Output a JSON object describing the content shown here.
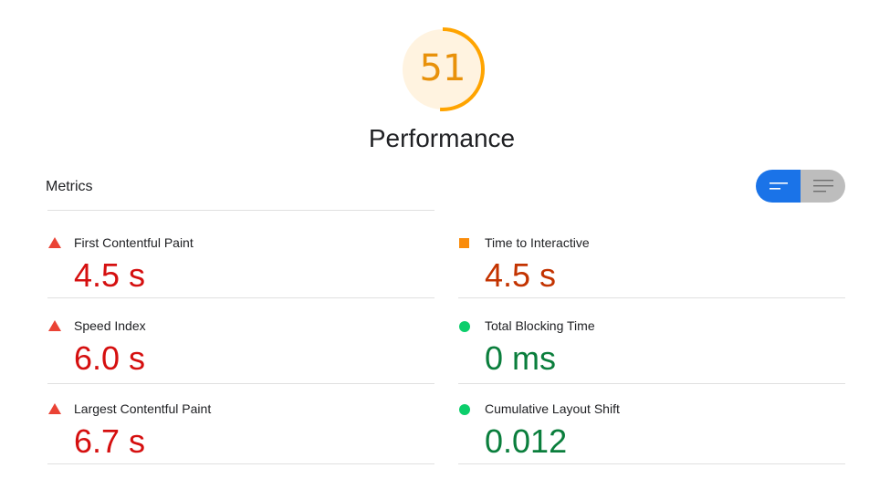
{
  "score": {
    "value": "51",
    "fraction": 0.51,
    "ring_color": "#ffa400",
    "fill_color": "#fff3e0",
    "text_color": "#e8910a"
  },
  "category_title": "Performance",
  "metrics_heading": "Metrics",
  "view_toggle": {
    "active": "compact-view",
    "items": [
      "compact-view-icon",
      "expanded-view-icon"
    ]
  },
  "metrics": [
    {
      "label": "First Contentful Paint",
      "value": "4.5 s",
      "status": "fail",
      "icon": "fail-triangle-icon",
      "color": "#d50f0f"
    },
    {
      "label": "Time to Interactive",
      "value": "4.5 s",
      "status": "average",
      "icon": "average-square-icon",
      "color": "#c33300"
    },
    {
      "label": "Speed Index",
      "value": "6.0 s",
      "status": "fail",
      "icon": "fail-triangle-icon",
      "color": "#d50f0f"
    },
    {
      "label": "Total Blocking Time",
      "value": "0 ms",
      "status": "pass",
      "icon": "pass-circle-icon",
      "color": "#0a7e3c"
    },
    {
      "label": "Largest Contentful Paint",
      "value": "6.7 s",
      "status": "fail",
      "icon": "fail-triangle-icon",
      "color": "#d50f0f"
    },
    {
      "label": "Cumulative Layout Shift",
      "value": "0.012",
      "status": "pass",
      "icon": "pass-circle-icon",
      "color": "#0a7e3c"
    }
  ]
}
